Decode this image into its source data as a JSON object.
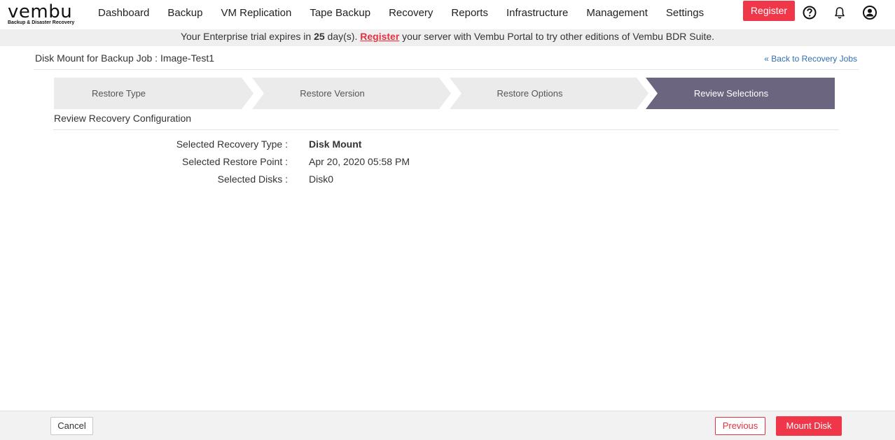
{
  "header": {
    "logo_text": "vembu",
    "logo_tagline": "Backup & Disaster Recovery",
    "nav": [
      "Dashboard",
      "Backup",
      "VM Replication",
      "Tape Backup",
      "Recovery",
      "Reports",
      "Infrastructure",
      "Management",
      "Settings"
    ],
    "register_label": "Register",
    "icons": [
      "help-icon",
      "bell-icon",
      "user-icon"
    ]
  },
  "banner": {
    "prefix": "Your Enterprise trial expires in ",
    "days": "25",
    "days_suffix": " day(s). ",
    "link": "Register",
    "suffix": " your server with Vembu Portal to try other editions of Vembu BDR Suite."
  },
  "page": {
    "title": "Disk Mount for Backup Job  : Image-Test1",
    "back_link": "« Back to Recovery Jobs"
  },
  "wizard": {
    "steps": [
      "Restore Type",
      "Restore Version",
      "Restore Options",
      "Review Selections"
    ],
    "active_index": 3
  },
  "review": {
    "section_title": "Review Recovery Configuration",
    "rows": [
      {
        "label": "Selected Recovery Type :",
        "value": "Disk Mount"
      },
      {
        "label": "Selected Restore Point :",
        "value": "Apr 20, 2020 05:58 PM"
      },
      {
        "label": "Selected Disks :",
        "value": "Disk0"
      }
    ]
  },
  "footer": {
    "cancel_label": "Cancel",
    "previous_label": "Previous",
    "mount_label": "Mount Disk"
  },
  "colors": {
    "accent": "#f0374a",
    "step_active": "#6b6580",
    "step_inactive": "#ebebeb",
    "link": "#2f6fb5"
  }
}
